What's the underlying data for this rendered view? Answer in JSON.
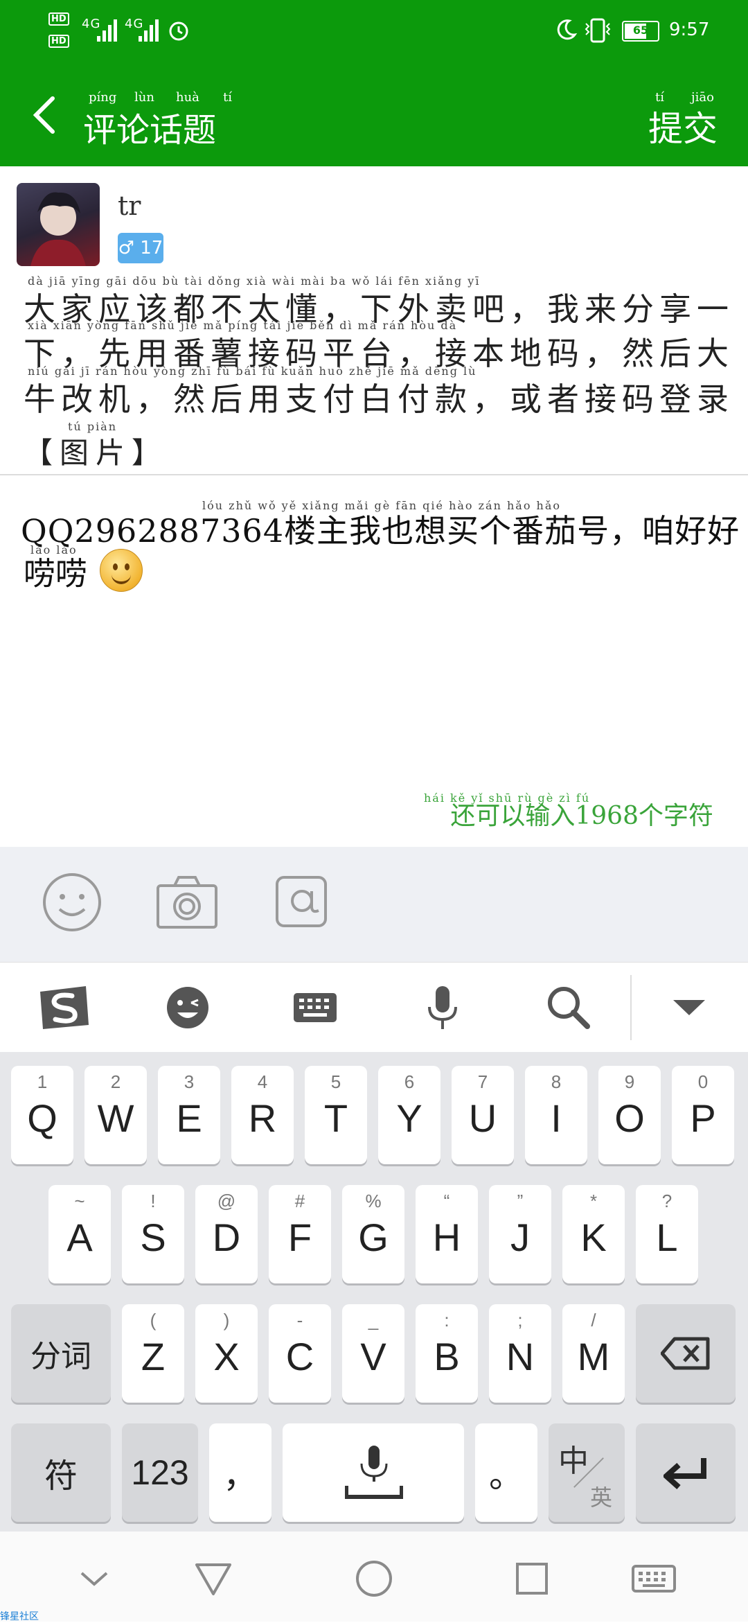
{
  "status_bar": {
    "hd1": "HD",
    "hd2": "HD",
    "net1": "4G",
    "net2": "4G",
    "battery": "65",
    "time": "9:57"
  },
  "header": {
    "title": "评论话题",
    "title_pinyin": [
      "píng",
      "lùn",
      "huà",
      "tí"
    ],
    "submit": "提交",
    "submit_pinyin": [
      "tí",
      "jiāo"
    ]
  },
  "post": {
    "username": "tr",
    "gender_badge": "♂ 17",
    "lines": [
      "大家应该都不太懂，下外卖吧，我来分享一",
      "下，先用番薯接码平台，接本地码，然后大",
      "牛改机，然后用支付白付款，或者接码登录"
    ],
    "pinyin_lines": [
      "dà  jiā  yīng  gāi  dōu  bù  tài  dǒng      xià  wài  mài  ba       wǒ  lái  fēn  xiǎng  yī",
      "xià        xiān  yòng  fān  shǔ  jiē  mǎ  píng  tái      jiē  běn  dì  mǎ      rán  hòu  dà",
      "niú  gǎi  jī       rán  hòu  yòng  zhī  fù  bái  fù  kuǎn      huò  zhě  jiē  mǎ  dēng  lù"
    ],
    "picture_tag": "【图片】",
    "picture_pinyin": "tú  piàn"
  },
  "reply": {
    "line1": "QQ2962887364楼主我也想买个番茄号，咱好好",
    "line1_pinyin": "lóu  zhǔ  wǒ  yě  xiǎng  mǎi  gè  fān  qié  hào         zán  hǎo  hǎo",
    "line2": "唠唠",
    "line2_pinyin": "lào  lào"
  },
  "counter": {
    "text": "还可以输入1968个字符",
    "pinyin": "hái  kě  yǐ  shū  rù             gè  zì  fú"
  },
  "keyboard": {
    "row1": [
      {
        "main": "Q",
        "sub": "1"
      },
      {
        "main": "W",
        "sub": "2"
      },
      {
        "main": "E",
        "sub": "3"
      },
      {
        "main": "R",
        "sub": "4"
      },
      {
        "main": "T",
        "sub": "5"
      },
      {
        "main": "Y",
        "sub": "6"
      },
      {
        "main": "U",
        "sub": "7"
      },
      {
        "main": "I",
        "sub": "8"
      },
      {
        "main": "O",
        "sub": "9"
      },
      {
        "main": "P",
        "sub": "0"
      }
    ],
    "row2": [
      {
        "main": "A",
        "sub": "~"
      },
      {
        "main": "S",
        "sub": "!"
      },
      {
        "main": "D",
        "sub": "@"
      },
      {
        "main": "F",
        "sub": "#"
      },
      {
        "main": "G",
        "sub": "%"
      },
      {
        "main": "H",
        "sub": "“"
      },
      {
        "main": "J",
        "sub": "”"
      },
      {
        "main": "K",
        "sub": "*"
      },
      {
        "main": "L",
        "sub": "?"
      }
    ],
    "row3": [
      {
        "main": "Z",
        "sub": "("
      },
      {
        "main": "X",
        "sub": ")"
      },
      {
        "main": "C",
        "sub": "-"
      },
      {
        "main": "V",
        "sub": "_"
      },
      {
        "main": "B",
        "sub": ":"
      },
      {
        "main": "N",
        "sub": ";"
      },
      {
        "main": "M",
        "sub": "/"
      }
    ],
    "segment": "分词",
    "symbols": "符",
    "numbers": "123",
    "comma": "，",
    "period": "。",
    "lang_top": "中",
    "lang_bottom": "英"
  },
  "watermark": "锋星社区"
}
